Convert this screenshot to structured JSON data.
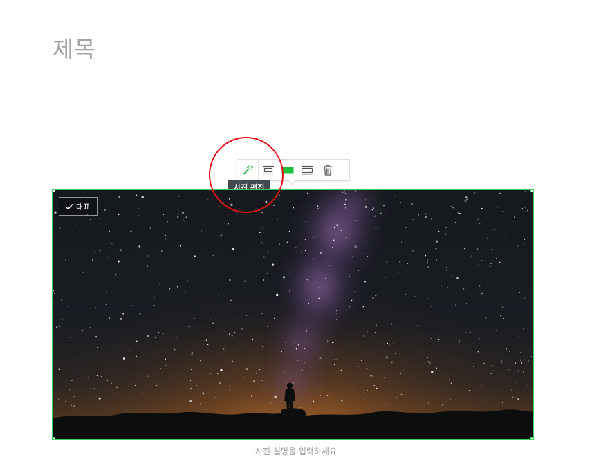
{
  "editor": {
    "title_placeholder": "제목",
    "caption_placeholder": "사진 설명을 입력하세요"
  },
  "image_toolbar": {
    "buttons": [
      {
        "name": "photo-edit",
        "icon": "magic-wand-icon",
        "active": true
      },
      {
        "name": "align-small",
        "icon": "image-small-icon",
        "active": false
      },
      {
        "name": "align-full",
        "icon": "image-full-width-icon",
        "active": true
      },
      {
        "name": "align-document",
        "icon": "image-document-width-icon",
        "active": false
      },
      {
        "name": "delete",
        "icon": "trash-icon",
        "active": false
      }
    ],
    "tooltip": "사진 편집"
  },
  "image": {
    "representative_badge": "대표",
    "selected": true,
    "description": "Night sky with Milky Way over a silhouetted person standing on a rock"
  },
  "colors": {
    "selection_green": "#3ccf5c",
    "annotation_red": "#e1121a",
    "tooltip_bg": "#444a52",
    "title_gray": "#a3a3a3"
  }
}
